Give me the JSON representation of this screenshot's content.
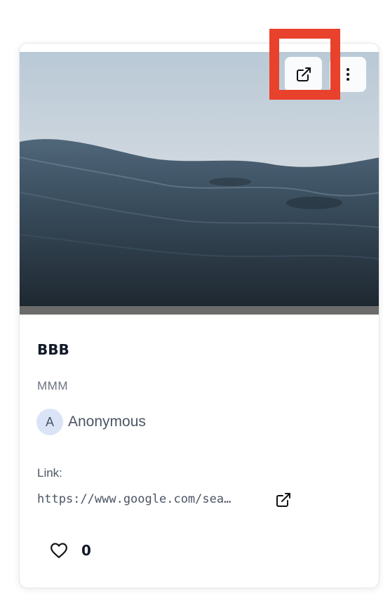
{
  "card": {
    "title": "BBB",
    "subtitle": "MMM",
    "author": {
      "initial": "A",
      "name": "Anonymous"
    },
    "link": {
      "label": "Link:",
      "url": "https://www.google.com/sea…"
    },
    "likes": "0"
  },
  "icons": {
    "open_external": "external-link-icon",
    "menu": "vertical-dots-icon",
    "like": "heart-outline-icon"
  },
  "colors": {
    "highlight": "#e8412c",
    "title": "#111827",
    "muted": "#6b7280",
    "avatar_bg": "#dbe4f7"
  }
}
